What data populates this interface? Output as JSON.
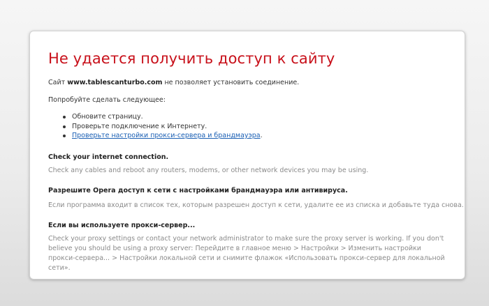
{
  "error_page": {
    "title": "Не удается получить доступ к сайту",
    "site_prefix": "Сайт ",
    "site_domain": "www.tablescanturbo.com",
    "site_suffix": " не позволяет установить соединение.",
    "try_text": "Попробуйте сделать следующее:",
    "suggestions": {
      "reload": "Обновите страницу.",
      "check_connection": "Проверьте подключение к Интернету.",
      "proxy_link": "Проверьте настройки прокси-сервера и брандмауэра",
      "proxy_link_suffix": "."
    },
    "sections": [
      {
        "heading": "Check your internet connection.",
        "body": "Check any cables and reboot any routers, modems, or other network devices you may be using."
      },
      {
        "heading": "Разрешите Opera доступ к сети с настройками брандмауэра или антивируса.",
        "body": "Если программа входит в список тех, которым разрешен доступ к сети, удалите ее из списка и добавьте туда снова."
      },
      {
        "heading": "Если вы используете прокси-сервер...",
        "body": "Check your proxy settings or contact your network administrator to make sure the proxy server is working. If you don't believe you should be using a proxy server: Перейдите в главное меню > Настройки > Изменить настройки прокси-сервера... > Настройки локальной сети и снимите флажок «Использовать прокси-сервер для локальной сети»."
      }
    ]
  },
  "colors": {
    "title": "#c8101a",
    "link": "#1a5fb4",
    "body_text": "#333333",
    "muted_text": "#8a8a8a",
    "page_background": "#ececec",
    "card_background": "#ffffff"
  }
}
